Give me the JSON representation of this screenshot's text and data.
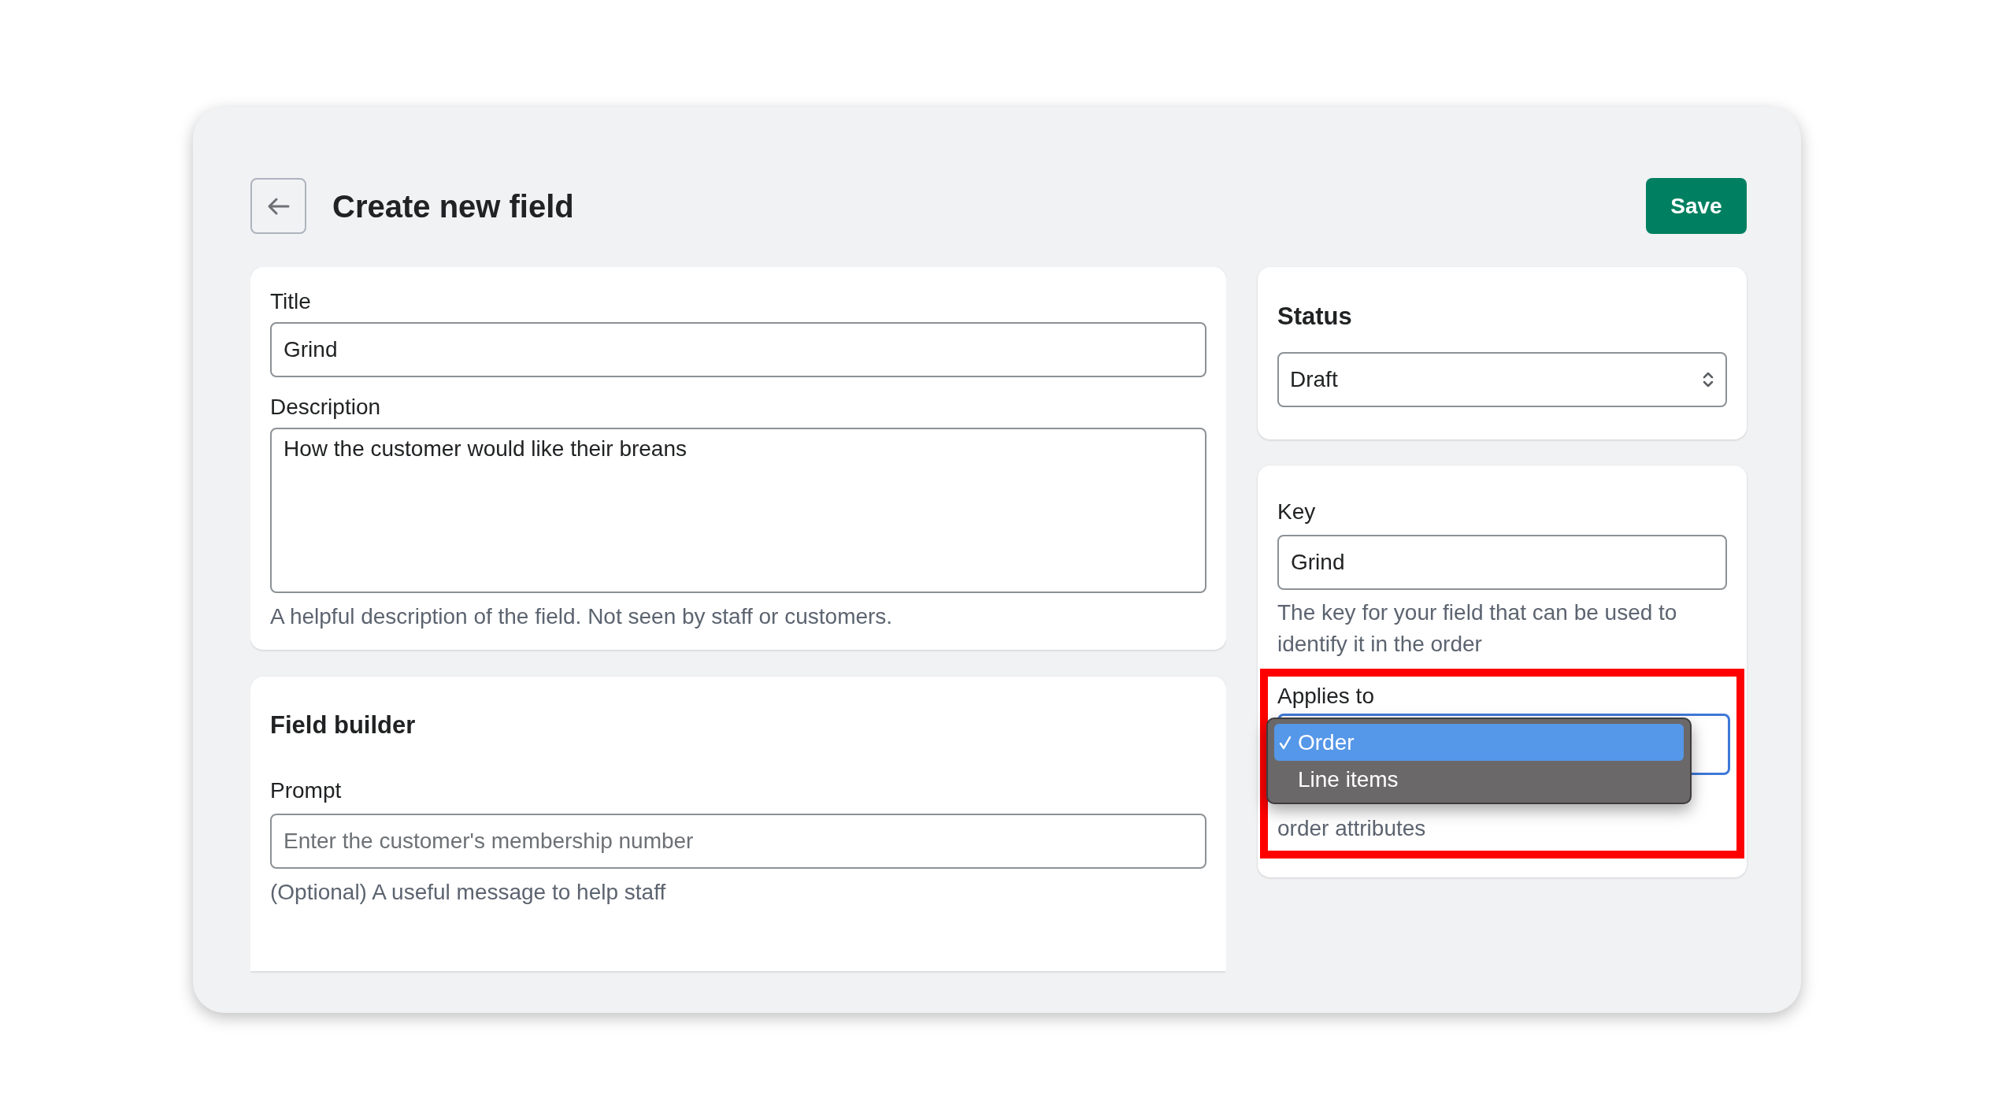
{
  "header": {
    "title": "Create new field",
    "save_button": "Save"
  },
  "details_card": {
    "title_field": {
      "label": "Title",
      "value": "Grind"
    },
    "description_field": {
      "label": "Description",
      "value": "How the customer would like their breans",
      "help": "A helpful description of the field. Not seen by staff or customers."
    }
  },
  "field_builder": {
    "heading": "Field builder",
    "prompt": {
      "label": "Prompt",
      "placeholder": "Enter the customer's membership number",
      "help": "(Optional) A useful message to help staff"
    }
  },
  "status_card": {
    "heading": "Status",
    "select": {
      "value": "Draft"
    }
  },
  "key_card": {
    "key": {
      "label": "Key",
      "value": "Grind",
      "help": "The key for your field that can be used to identify it in the order"
    },
    "applies_to": {
      "label": "Applies to",
      "help": "order attributes",
      "options": [
        {
          "label": "Order",
          "selected": true
        },
        {
          "label": "Line items",
          "selected": false
        }
      ]
    }
  }
}
